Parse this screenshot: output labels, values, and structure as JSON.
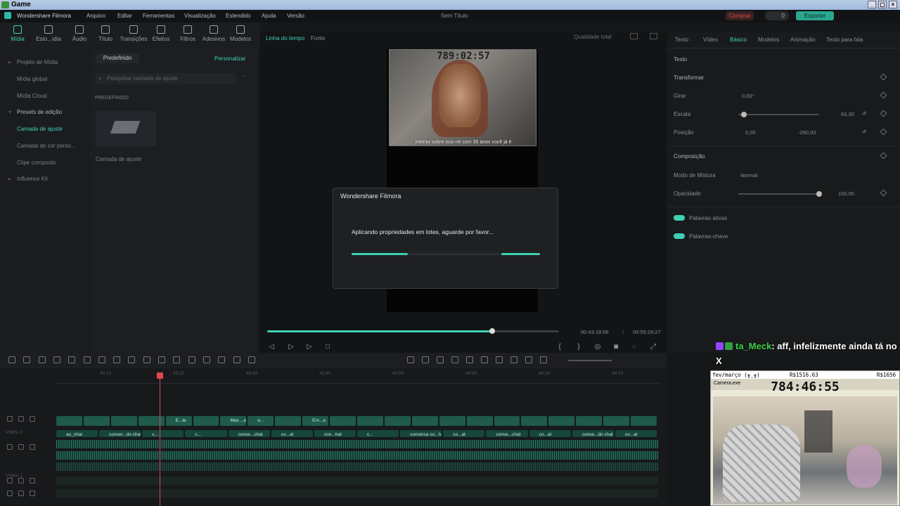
{
  "os_window": {
    "title": "Game"
  },
  "app": {
    "name": "Wondershare Filmora",
    "project_title": "Sem Título",
    "menu": [
      "Arquivo",
      "Editar",
      "Ferramentas",
      "Visualização",
      "Estendido",
      "Ajuda",
      "Versão"
    ],
    "buy_label": "Comprar",
    "credits": "0",
    "export_label": "Exportar"
  },
  "toolbar": [
    {
      "label": "Mídia",
      "icon": "media-icon",
      "active": true
    },
    {
      "label": "Esto...ídia",
      "icon": "stock-media-icon",
      "active": false
    },
    {
      "label": "Áudio",
      "icon": "audio-icon",
      "active": false
    },
    {
      "label": "Título",
      "icon": "title-icon",
      "active": false
    },
    {
      "label": "Transições",
      "icon": "transitions-icon",
      "active": false
    },
    {
      "label": "Efeitos",
      "icon": "effects-icon",
      "active": false
    },
    {
      "label": "Filtros",
      "icon": "filters-icon",
      "active": false
    },
    {
      "label": "Adesivos",
      "icon": "stickers-icon",
      "active": false
    },
    {
      "label": "Modelos",
      "icon": "templates-icon",
      "active": false
    }
  ],
  "left_nav": [
    {
      "label": "Projeto de Mídia",
      "active": false
    },
    {
      "label": "Mídia global",
      "active": false
    },
    {
      "label": "Mídia Cloud",
      "active": false
    },
    {
      "label": "Presets de edição",
      "active": false
    },
    {
      "label": "Camada de ajuste",
      "active": true
    },
    {
      "label": "Camada de cor perso...",
      "active": false
    },
    {
      "label": "Clipe composto",
      "active": false
    },
    {
      "label": "Influence Kit",
      "active": false
    }
  ],
  "asset_panel": {
    "tab_preset": "Predefinido",
    "tab_custom": "Personalizar",
    "search_placeholder": "Pesquisar camada de ajuste",
    "section": "PREDEFINIDO",
    "item_label": "Camada de ajuste"
  },
  "preview": {
    "tab_timeline": "Linha do tempo",
    "tab_source": "Fonte",
    "quality": "Qualidade total",
    "overlay_timestamp": "789:02:57",
    "subtitle": "interior sobre isso né com 35 anos você já é",
    "current_time": "00:43:18:06",
    "total_time": "00:55:29:27",
    "progress": 0.77
  },
  "dialog": {
    "title": "Wondershare Filmora",
    "message": "Aplicando propriedades em lotes, aguarde por favor..."
  },
  "right_panel": {
    "tabs": [
      {
        "label": "Texto",
        "active": false
      },
      {
        "label": "Vídeo",
        "active": false
      },
      {
        "label": "Básico",
        "active": true
      },
      {
        "label": "Modelos",
        "active": false
      },
      {
        "label": "Animação",
        "active": false
      },
      {
        "label": "Texto para fala",
        "active": false
      }
    ],
    "section_text": "Texto",
    "transform": "Transformar",
    "rotate_label": "Girar",
    "rotate_value": "0,00°",
    "scale_label": "Escala",
    "scale_value": "63,30",
    "scale_level": 0.07,
    "position_label": "Posição",
    "position_x": "0,00",
    "position_y": "-290,00",
    "composition": "Composição",
    "blend_label": "Modo de Mistura",
    "blend_value": "Normal",
    "opacity_label": "Opacidade",
    "opacity_value": "100,00",
    "opacity_level": 1.0,
    "active_words": "Palavras ativas",
    "keywords": "Palavras-chave"
  },
  "timeline": {
    "ticks": [
      "43:10",
      "43:20",
      "43:30",
      "43:40",
      "43:50",
      "44:00",
      "44:10",
      "44:20"
    ],
    "video_clips": [
      "",
      "",
      "",
      "",
      "E...te",
      "",
      "Mas ...erete",
      "e...",
      "",
      "Em...a",
      "",
      "",
      "",
      "",
      "",
      "",
      "",
      "",
      "",
      "",
      "",
      ""
    ],
    "text_clips": [
      "ao_chat",
      "conver...do chat",
      "c...",
      "c...",
      "conve...chat",
      "co...at",
      "con...hat",
      "c...",
      "conversa so...hat do chat",
      "co...at",
      "conve...chat",
      "co...at",
      "conve...do chat",
      "co...at"
    ],
    "track_labels": [
      "Vídeo 2",
      "Vídeo 1"
    ]
  },
  "chat": {
    "user": "ta_Meck",
    "message": ": aff, infelizmente ainda tá no X"
  },
  "cam_overlay": {
    "top_text": "fev/março (╥_╥)",
    "amount_1": "R$1516.63",
    "amount_2": "R$1656",
    "window_title": "Camera.exe",
    "clock": "784:46:55"
  }
}
